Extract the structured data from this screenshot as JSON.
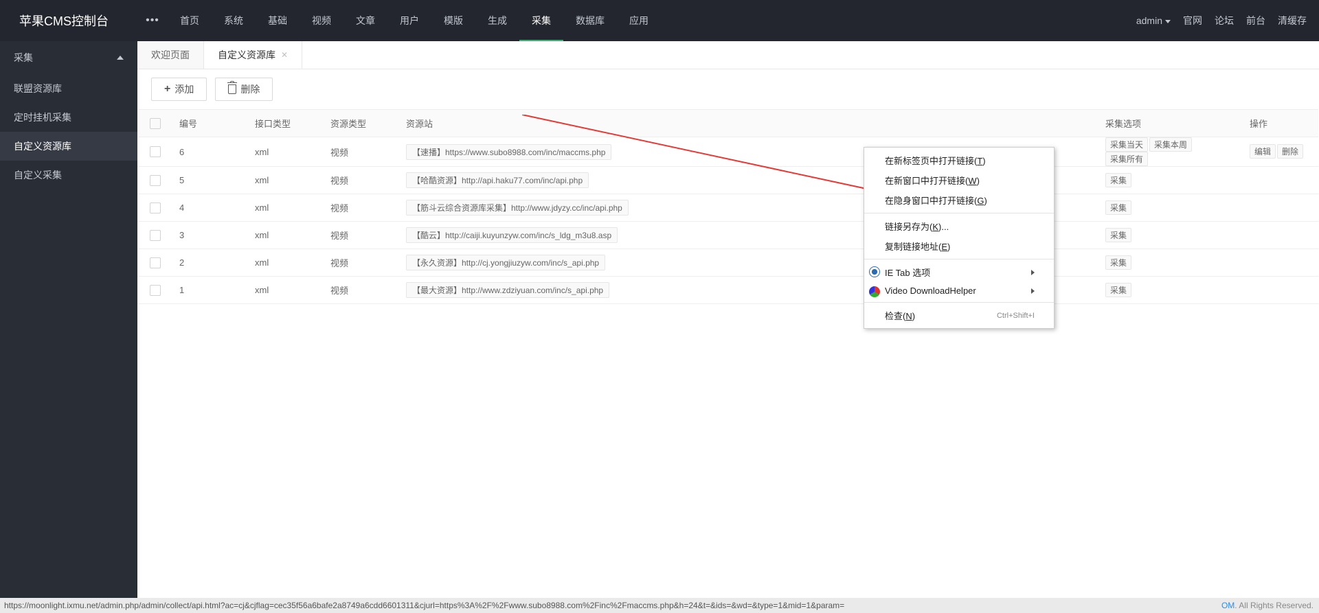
{
  "logo": "苹果CMS控制台",
  "more_icon": "•••",
  "topnav": [
    "首页",
    "系统",
    "基础",
    "视频",
    "文章",
    "用户",
    "模版",
    "生成",
    "采集",
    "数据库",
    "应用"
  ],
  "topnav_active": 8,
  "admin_label": "admin",
  "right_links": [
    "官网",
    "论坛",
    "前台",
    "清缓存"
  ],
  "sidebar": {
    "head": "采集",
    "items": [
      "联盟资源库",
      "定时挂机采集",
      "自定义资源库",
      "自定义采集"
    ],
    "active": 2
  },
  "tabs": [
    {
      "label": "欢迎页面",
      "closable": false,
      "active": false
    },
    {
      "label": "自定义资源库",
      "closable": true,
      "active": true
    }
  ],
  "toolbar": {
    "add": "添加",
    "delete": "删除"
  },
  "table": {
    "headers": {
      "id": "编号",
      "iface": "接口类型",
      "rtype": "资源类型",
      "site": "资源站",
      "collect": "采集选项",
      "ops": "操作"
    },
    "collect_buttons": [
      "采集当天",
      "采集本周",
      "采集所有"
    ],
    "collect_prefix_partial": "采集",
    "ops_buttons": [
      "编辑",
      "删除"
    ],
    "rows": [
      {
        "id": "6",
        "iface": "xml",
        "rtype": "视频",
        "site": "【速播】https://www.subo8988.com/inc/maccms.php"
      },
      {
        "id": "5",
        "iface": "xml",
        "rtype": "视频",
        "site": "【哈酷资源】http://api.haku77.com/inc/api.php"
      },
      {
        "id": "4",
        "iface": "xml",
        "rtype": "视频",
        "site": "【筋斗云综合资源库采集】http://www.jdyzy.cc/inc/api.php"
      },
      {
        "id": "3",
        "iface": "xml",
        "rtype": "视频",
        "site": "【酷云】http://caiji.kuyunzyw.com/inc/s_ldg_m3u8.asp"
      },
      {
        "id": "2",
        "iface": "xml",
        "rtype": "视频",
        "site": "【永久资源】http://cj.yongjiuzyw.com/inc/s_api.php"
      },
      {
        "id": "1",
        "iface": "xml",
        "rtype": "视频",
        "site": "【最大资源】http://www.zdziyuan.com/inc/s_api.php"
      }
    ]
  },
  "context_menu": {
    "open_new_tab": {
      "pre": "在新标签页中打开链接(",
      "u": "T",
      "post": ")"
    },
    "open_new_window": {
      "pre": "在新窗口中打开链接(",
      "u": "W",
      "post": ")"
    },
    "open_incognito": {
      "pre": "在隐身窗口中打开链接(",
      "u": "G",
      "post": ")"
    },
    "save_link_as": {
      "pre": "链接另存为(",
      "u": "K",
      "post": ")..."
    },
    "copy_link": {
      "pre": "复制链接地址(",
      "u": "E",
      "post": ")"
    },
    "ie_tab": "IE Tab 选项",
    "video_dl": "Video DownloadHelper",
    "inspect": {
      "pre": "检查(",
      "u": "N",
      "post": ")"
    },
    "inspect_shortcut": "Ctrl+Shift+I"
  },
  "footer_url": "https://moonlight.ixmu.net/admin.php/admin/collect/api.html?ac=cj&cjflag=cec35f56a6bafe2a8749a6cdd6601311&cjurl=https%3A%2F%2Fwww.subo8988.com%2Finc%2Fmaccms.php&h=24&t=&ids=&wd=&type=1&mid=1&param=",
  "footer_rights": ". All Rights Reserved.",
  "footer_om": "OM"
}
